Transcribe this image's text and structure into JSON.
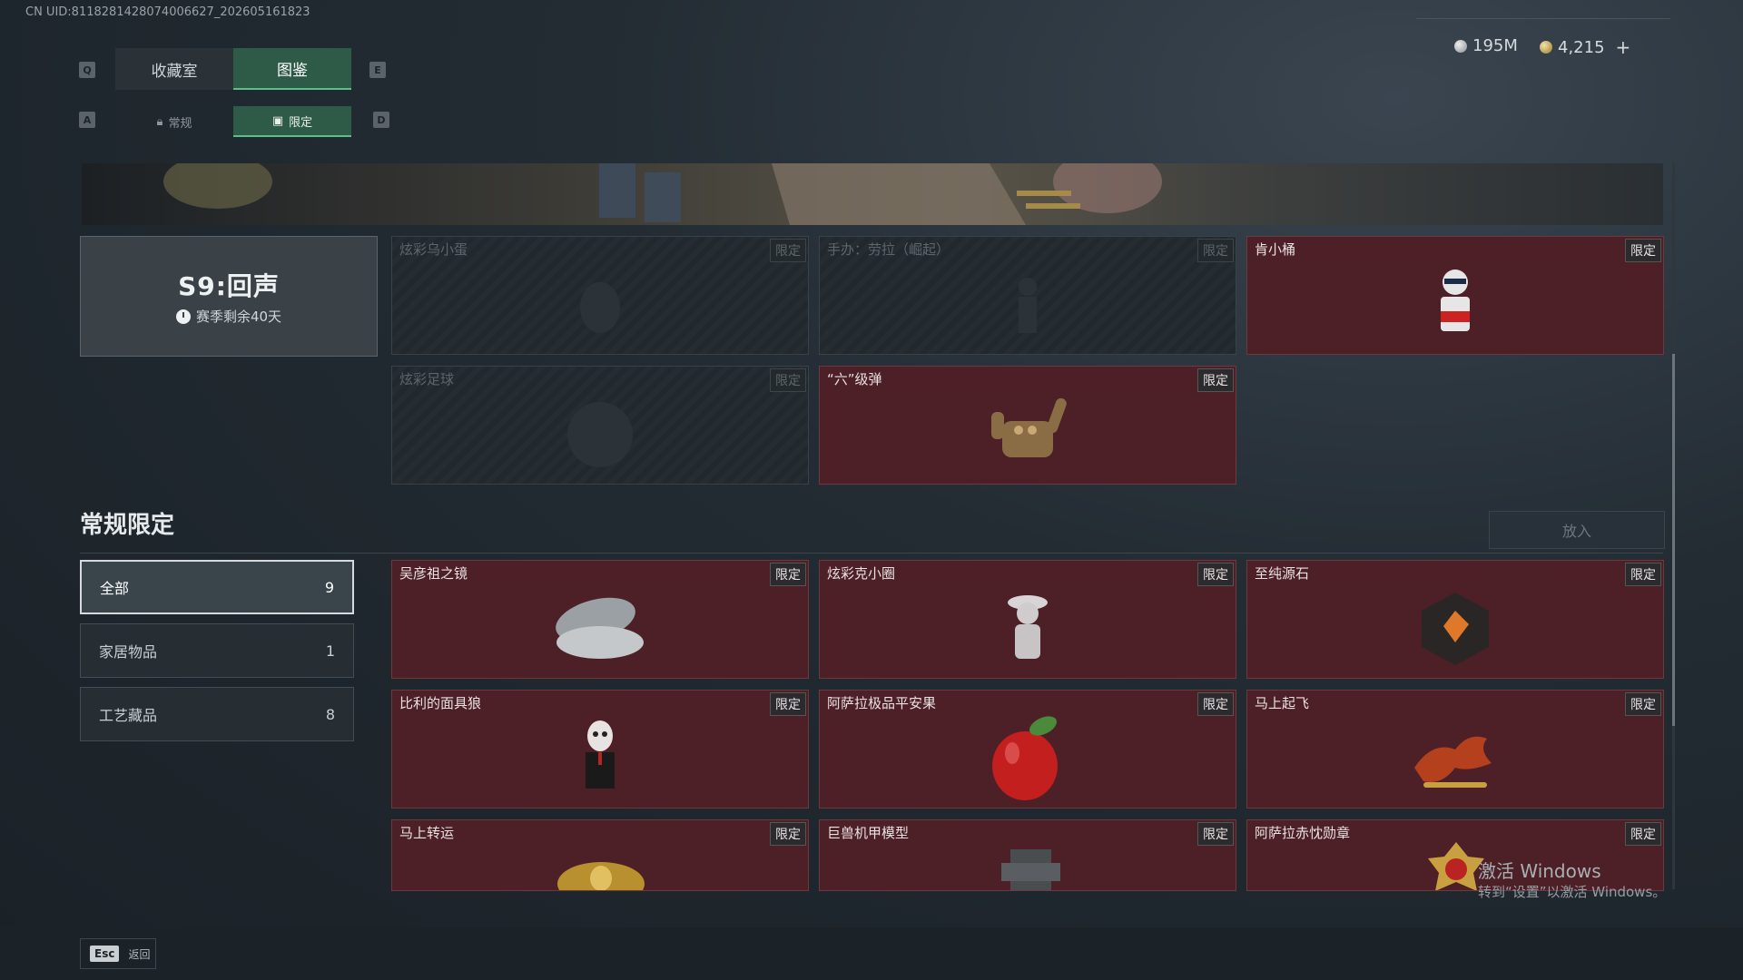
{
  "uid": "CN UID:8118281428074006627_202605161823",
  "currency": {
    "silver": "195M",
    "gold": "4,215",
    "add": "+"
  },
  "keys": {
    "prev_tab": "Q",
    "next_tab": "E",
    "prev_sub": "A",
    "next_sub": "D"
  },
  "tabs": [
    {
      "label": "收藏室"
    },
    {
      "label": "图鉴"
    }
  ],
  "subtabs": [
    {
      "label": "常规"
    },
    {
      "label": "限定"
    }
  ],
  "season": {
    "title": "S9:回声",
    "remaining": "赛季剩余40天"
  },
  "top_cards": [
    {
      "name": "炫彩乌小蛋",
      "badge": "限定",
      "locked": true
    },
    {
      "name": "手办：劳拉（崛起）",
      "badge": "限定",
      "locked": true
    },
    {
      "name": "肯小桶",
      "badge": "限定",
      "locked": false
    },
    {
      "name": "炫彩足球",
      "badge": "限定",
      "locked": true
    },
    {
      "name": "“六”级弹",
      "badge": "限定",
      "locked": false
    }
  ],
  "section": {
    "title": "常规限定",
    "put_button": "放入"
  },
  "filters": [
    {
      "label": "全部",
      "count": "9"
    },
    {
      "label": "家居物品",
      "count": "1"
    },
    {
      "label": "工艺藏品",
      "count": "8"
    }
  ],
  "items": [
    {
      "name": "吴彦祖之镜",
      "badge": "限定"
    },
    {
      "name": "炫彩克小圈",
      "badge": "限定"
    },
    {
      "name": "至纯源石",
      "badge": "限定"
    },
    {
      "name": "比利的面具狼",
      "badge": "限定"
    },
    {
      "name": "阿萨拉极品平安果",
      "badge": "限定"
    },
    {
      "name": "马上起飞",
      "badge": "限定"
    },
    {
      "name": "马上转运",
      "badge": "限定"
    },
    {
      "name": "巨兽机甲模型",
      "badge": "限定"
    },
    {
      "name": "阿萨拉赤忱勋章",
      "badge": "限定"
    }
  ],
  "footer": {
    "esc_key": "Esc",
    "back": "返回"
  },
  "watermark": {
    "line1": "激活 Windows",
    "line2": "转到“设置”以激活 Windows。"
  }
}
